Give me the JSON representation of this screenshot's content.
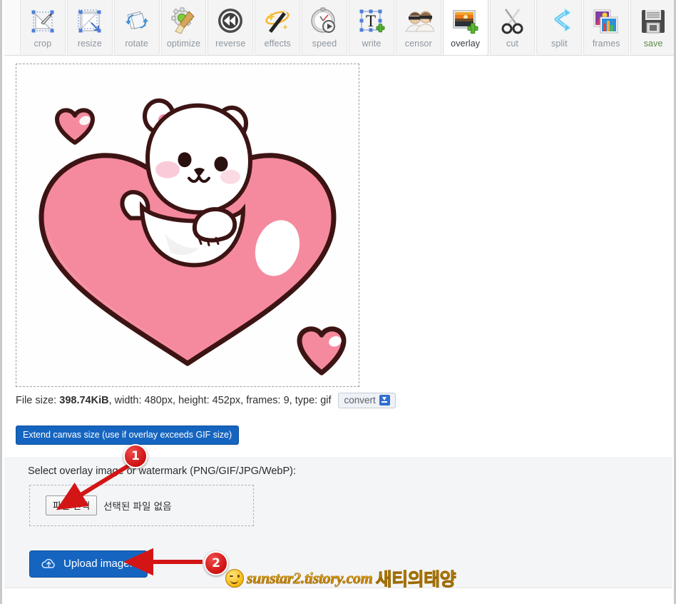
{
  "toolbar": {
    "items": [
      {
        "label": "crop",
        "icon": "crop-icon",
        "selected": false
      },
      {
        "label": "resize",
        "icon": "resize-icon",
        "selected": false
      },
      {
        "label": "rotate",
        "icon": "rotate-icon",
        "selected": false
      },
      {
        "label": "optimize",
        "icon": "optimize-icon",
        "selected": false
      },
      {
        "label": "reverse",
        "icon": "reverse-icon",
        "selected": false
      },
      {
        "label": "effects",
        "icon": "effects-icon",
        "selected": false
      },
      {
        "label": "speed",
        "icon": "speed-icon",
        "selected": false
      },
      {
        "label": "write",
        "icon": "write-icon",
        "selected": false
      },
      {
        "label": "censor",
        "icon": "censor-icon",
        "selected": false
      },
      {
        "label": "overlay",
        "icon": "overlay-icon",
        "selected": true
      },
      {
        "label": "cut",
        "icon": "cut-icon",
        "selected": false
      },
      {
        "label": "split",
        "icon": "split-icon",
        "selected": false
      },
      {
        "label": "frames",
        "icon": "frames-icon",
        "selected": false
      },
      {
        "label": "save",
        "icon": "save-icon",
        "selected": false
      }
    ]
  },
  "preview": {
    "alt": "white bear cub lying on a large pink heart with two small pink hearts",
    "colors": {
      "heart_fill": "#f58a9e",
      "heart_fill_light": "#f79bab",
      "outline": "#3d1414",
      "bear_fill": "#ffffff",
      "cheek": "#f9cbd8",
      "ear_inner": "#f48fae",
      "canvas_bg": "#fefefe"
    }
  },
  "fileinfo": {
    "label_size": "File size:",
    "size_value": "398.74KiB",
    "rest": ", width: 480px, height: 452px, frames: 9, type: gif",
    "convert_label": "convert",
    "convert_icon": "download-icon"
  },
  "extend_button": {
    "label": "Extend canvas size (use if overlay exceeds GIF size)",
    "color": "#1565c0"
  },
  "overlay_form": {
    "prompt": "Select overlay image or watermark (PNG/GIF/JPG/WebP):",
    "choose_file_label": "파일 선택",
    "no_file_label": "선택된 파일 없음",
    "upload_label": "Upload image!",
    "upload_icon": "cloud-upload-icon",
    "upload_color": "#1565c0"
  },
  "annotations": {
    "badges": [
      {
        "id": "1",
        "text": "1"
      },
      {
        "id": "2",
        "text": "2"
      }
    ],
    "arrow_color": "#d31515"
  },
  "watermark": {
    "face_icon": "winking-face-icon",
    "url": "sunstar2.tistory.com",
    "korean": "새티의태양"
  }
}
